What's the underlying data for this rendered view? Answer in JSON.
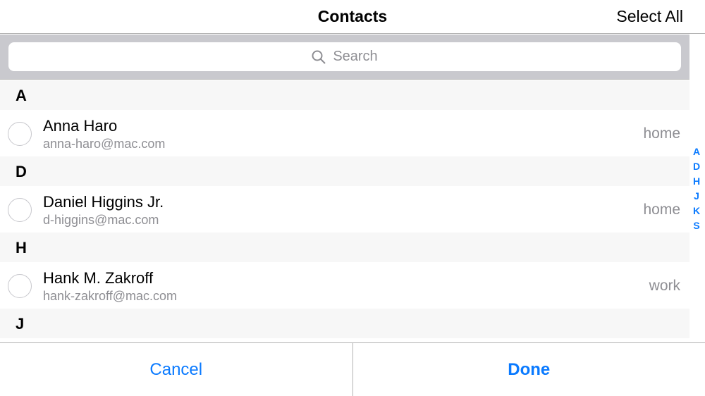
{
  "nav": {
    "title": "Contacts",
    "select_all": "Select All"
  },
  "search": {
    "placeholder": "Search"
  },
  "sections": [
    {
      "letter": "A",
      "contacts": [
        {
          "name": "Anna Haro",
          "email": "anna-haro@mac.com",
          "label": "home"
        }
      ]
    },
    {
      "letter": "D",
      "contacts": [
        {
          "name": "Daniel Higgins Jr.",
          "email": "d-higgins@mac.com",
          "label": "home"
        }
      ]
    },
    {
      "letter": "H",
      "contacts": [
        {
          "name": "Hank M. Zakroff",
          "email": "hank-zakroff@mac.com",
          "label": "work"
        }
      ]
    },
    {
      "letter": "J",
      "contacts": []
    }
  ],
  "index": [
    "A",
    "D",
    "H",
    "J",
    "K",
    "S"
  ],
  "footer": {
    "cancel": "Cancel",
    "done": "Done"
  }
}
